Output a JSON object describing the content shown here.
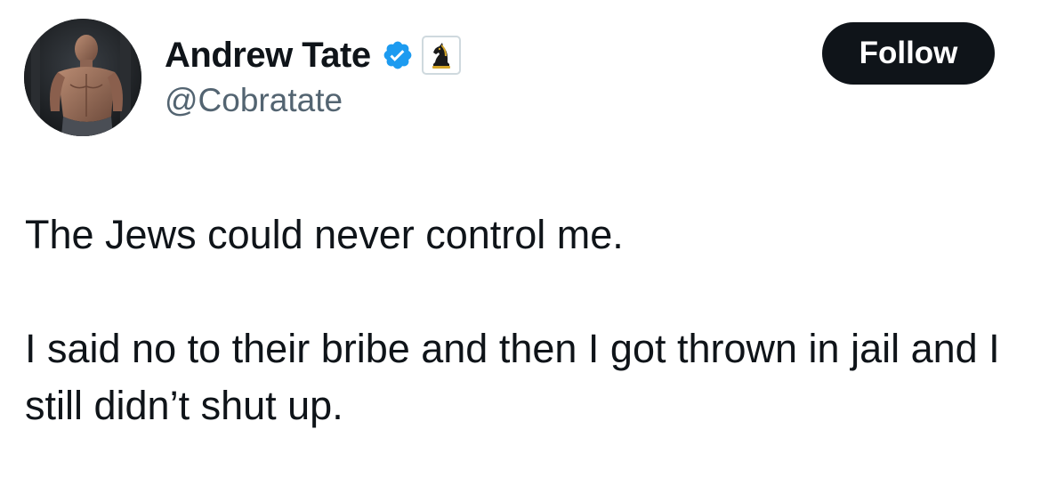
{
  "author": {
    "display_name": "Andrew Tate",
    "handle": "@Cobratate",
    "verified": true,
    "verified_color": "#1d9bf0",
    "affiliate_badge_icon": "chess-knight-icon",
    "avatar_icon": "profile-photo"
  },
  "follow_button": {
    "label": "Follow",
    "background": "#0f1419",
    "text_color": "#ffffff"
  },
  "tweet": {
    "paragraphs": [
      "The Jews could never control me.",
      "I said no to their bribe and then I got thrown in jail and I still didn’t shut up."
    ]
  }
}
